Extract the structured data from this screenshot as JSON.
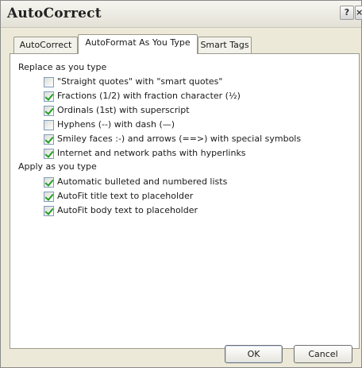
{
  "window": {
    "title": "AutoCorrect",
    "help_glyph": "?",
    "close_glyph": "×"
  },
  "tabs": [
    {
      "label": "AutoCorrect",
      "active": false
    },
    {
      "label": "AutoFormat As You Type",
      "active": true
    },
    {
      "label": "Smart Tags",
      "active": false
    }
  ],
  "replace_section": {
    "heading": "Replace as you type",
    "options": [
      {
        "label": "\"Straight quotes\" with \"smart quotes\"",
        "checked": false
      },
      {
        "label": "Fractions (1/2) with fraction character (½)",
        "checked": true
      },
      {
        "label": "Ordinals (1st) with superscript",
        "checked": true
      },
      {
        "label": "Hyphens (--) with dash (—)",
        "checked": false
      },
      {
        "label": "Smiley faces :-) and arrows (==>) with special symbols",
        "checked": true
      },
      {
        "label": "Internet and network paths with hyperlinks",
        "checked": true
      }
    ]
  },
  "apply_section": {
    "heading": "Apply as you type",
    "options": [
      {
        "label": "Automatic bulleted and numbered lists",
        "checked": true
      },
      {
        "label": "AutoFit title text to placeholder",
        "checked": true
      },
      {
        "label": "AutoFit body text to placeholder",
        "checked": true
      }
    ]
  },
  "buttons": {
    "ok_label": "OK",
    "cancel_label": "Cancel"
  }
}
